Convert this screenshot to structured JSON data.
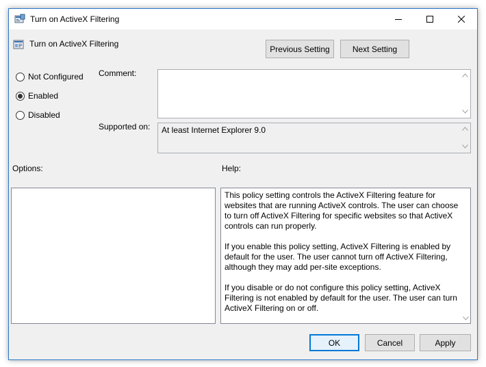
{
  "window": {
    "title": "Turn on ActiveX Filtering",
    "accent_color": "#2b76c9"
  },
  "header": {
    "setting_name": "Turn on ActiveX Filtering",
    "previous_label": "Previous Setting",
    "next_label": "Next Setting"
  },
  "state": {
    "options": [
      {
        "label": "Not Configured",
        "selected": false
      },
      {
        "label": "Enabled",
        "selected": true
      },
      {
        "label": "Disabled",
        "selected": false
      }
    ]
  },
  "comment": {
    "label": "Comment:",
    "value": ""
  },
  "supported": {
    "label": "Supported on:",
    "value": "At least Internet Explorer 9.0"
  },
  "options_panel": {
    "label": "Options:"
  },
  "help": {
    "label": "Help:",
    "paragraphs": [
      "This policy setting controls the ActiveX Filtering feature for websites that are running ActiveX controls. The user can choose to turn off ActiveX Filtering for specific websites so that ActiveX controls can run properly.",
      "If you enable this policy setting, ActiveX Filtering is enabled by default for the user. The user cannot turn off ActiveX Filtering, although they may add per-site exceptions.",
      "If you disable or do not configure this policy setting, ActiveX Filtering is not enabled by default for the user. The user can turn ActiveX Filtering on or off."
    ]
  },
  "footer": {
    "ok_label": "OK",
    "cancel_label": "Cancel",
    "apply_label": "Apply"
  },
  "icons": {
    "app": "policy-settings-icon",
    "minimize": "minimize-icon",
    "maximize": "maximize-icon",
    "close": "close-icon"
  }
}
